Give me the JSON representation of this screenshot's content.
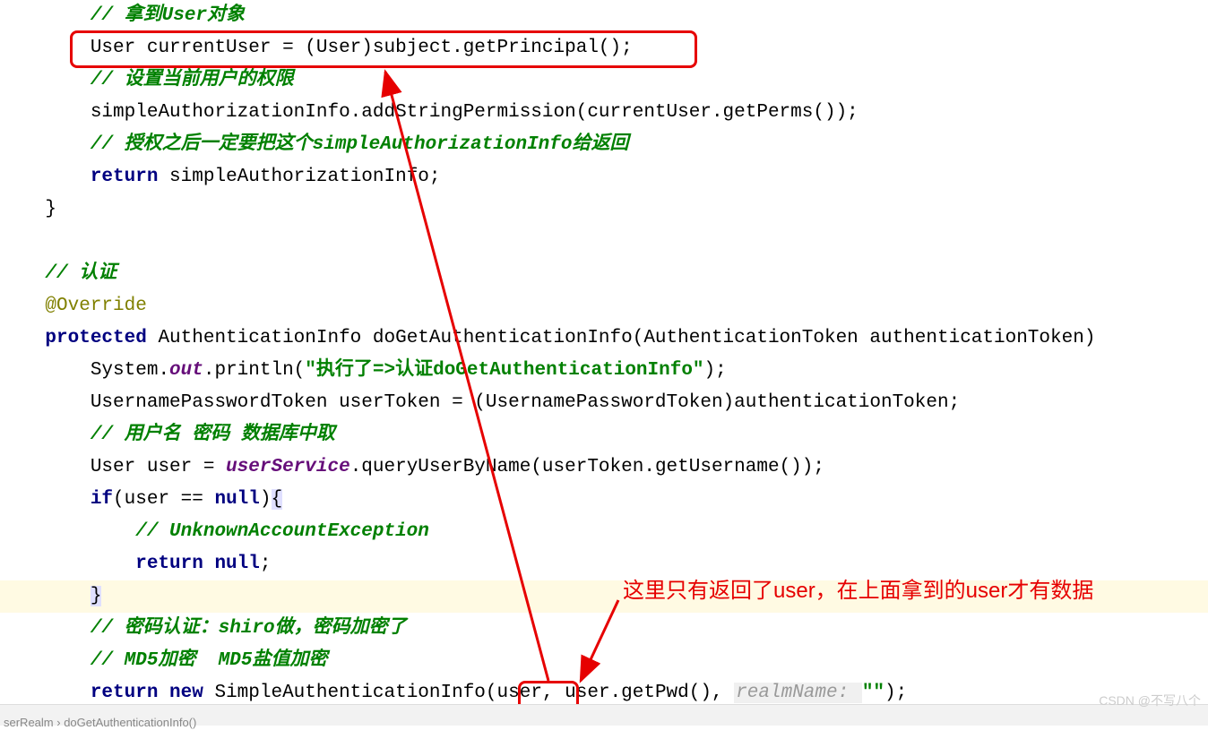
{
  "code": {
    "c1": "// 拿到User对象",
    "l2": "User currentUser = (User)subject.getPrincipal();",
    "c3": "// 设置当前用户的权限",
    "l4": "simpleAuthorizationInfo.addStringPermission(currentUser.getPerms());",
    "c5": "// 授权之后一定要把这个simpleAuthorizationInfo给返回",
    "l6_kw": "return",
    "l6_rest": " simpleAuthorizationInfo;",
    "l7": "}",
    "c8": "// 认证",
    "l9": "@Override",
    "l10_kw": "protected",
    "l10_rest": " AuthenticationInfo doGetAuthenticationInfo(AuthenticationToken authenticationToken)",
    "l11a": "System.",
    "l11b": "out",
    "l11c": ".println(",
    "l11d": "\"执行了=>认证doGetAuthenticationInfo\"",
    "l11e": ");",
    "l12": "UsernamePasswordToken userToken = (UsernamePasswordToken)authenticationToken;",
    "c13": "// 用户名 密码 数据库中取",
    "l14a": "User user = ",
    "l14b": "userService",
    "l14c": ".queryUserByName(userToken.getUsername());",
    "l15_kw1": "if",
    "l15a": "(user == ",
    "l15_kw2": "null",
    "l15b": ")",
    "l15c": "{",
    "c16": "// UnknownAccountException",
    "l17_kw": "return null",
    "l17b": ";",
    "l18": "}",
    "c19": "// 密码认证：shiro做，密码加密了",
    "c20": "// MD5加密  MD5盐值加密",
    "l21_kw": "return new",
    "l21a": " SimpleAuthenticationInfo(",
    "l21b": "user",
    "l21c": ", user.getPwd(), ",
    "l21d": "realmName: ",
    "l21e": "\"\"",
    "l21f": ");"
  },
  "annotation": {
    "text": "这里只有返回了user，在上面拿到的user才有数据"
  },
  "breadcrumb": {
    "a": "serRealm",
    "sep": " › ",
    "b": "doGetAuthenticationInfo()"
  },
  "watermark": "CSDN @不写八个"
}
